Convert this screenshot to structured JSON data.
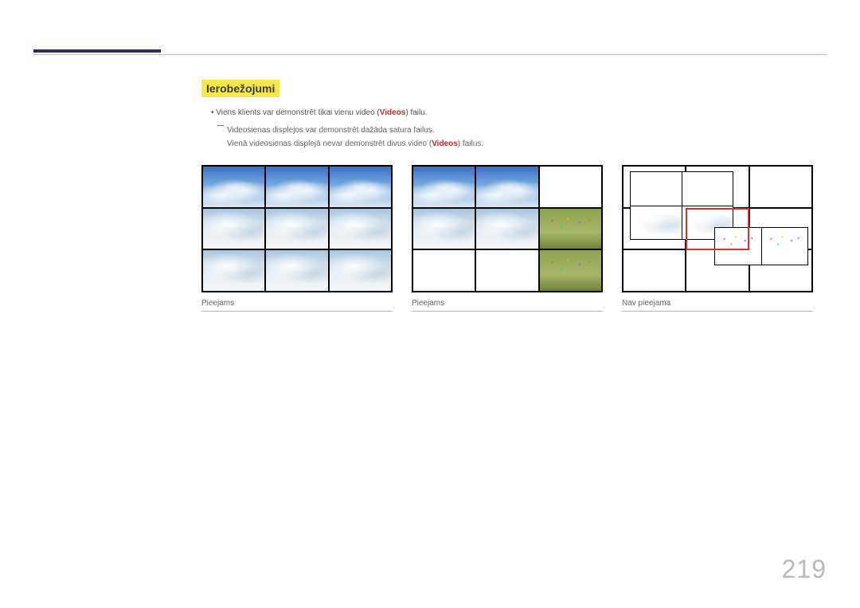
{
  "page_number": "219",
  "section_heading": "Ierobežojumi",
  "bullet_prefix": "Viens klients var demonstrēt tikai vienu video (",
  "bullet_accent": "Videos",
  "bullet_suffix": ") failu.",
  "note_line1": "Videosienas displejos var demonstrēt dažāda satura failus.",
  "note_line2_prefix": "Vienā videosienas displejā nevar demonstrēt divus video (",
  "note_line2_accent": "Videos",
  "note_line2_suffix": ") failus.",
  "captions": {
    "wall1": "Pieejams",
    "wall2": "Pieejams",
    "wall3": "Nav pieejama"
  }
}
